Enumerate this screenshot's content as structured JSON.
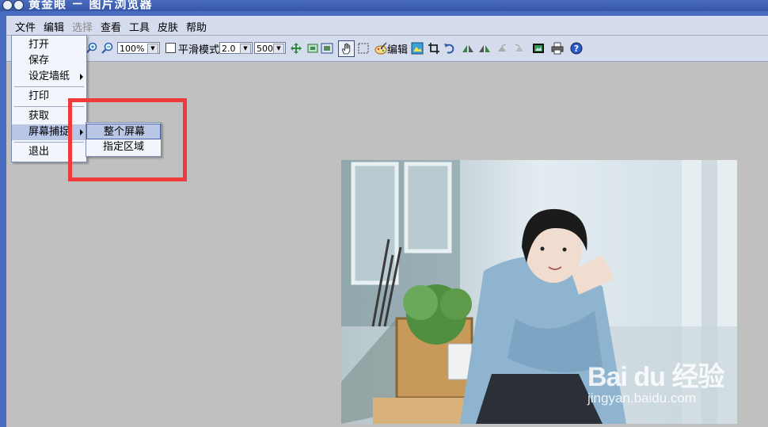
{
  "window": {
    "title": "黄金眼 － 图片浏览器"
  },
  "menubar": {
    "file": "文件",
    "edit": "编辑",
    "select": "选择",
    "view": "查看",
    "tools": "工具",
    "skin": "皮肤",
    "help": "帮助"
  },
  "toolbar": {
    "zoom_value": "100%",
    "smooth_label": "平滑模式",
    "factor_value": "2.0",
    "size_value": "500",
    "edit_label": "编辑"
  },
  "file_menu": {
    "open": "打开",
    "save": "保存",
    "wallpaper": "设定墙纸",
    "print": "打印",
    "acquire": "获取",
    "screen_capture": "屏幕捕捉",
    "exit": "退出"
  },
  "capture_submenu": {
    "full_screen": "整个屏幕",
    "region": "指定区域"
  },
  "watermark": {
    "brand": "Bai du 经验",
    "url": "jingyan.baidu.com"
  },
  "colors": {
    "highlight_box": "#f03a3a",
    "menu_highlight": "#b9c6e6",
    "title_bar": "#4a6cc0"
  }
}
